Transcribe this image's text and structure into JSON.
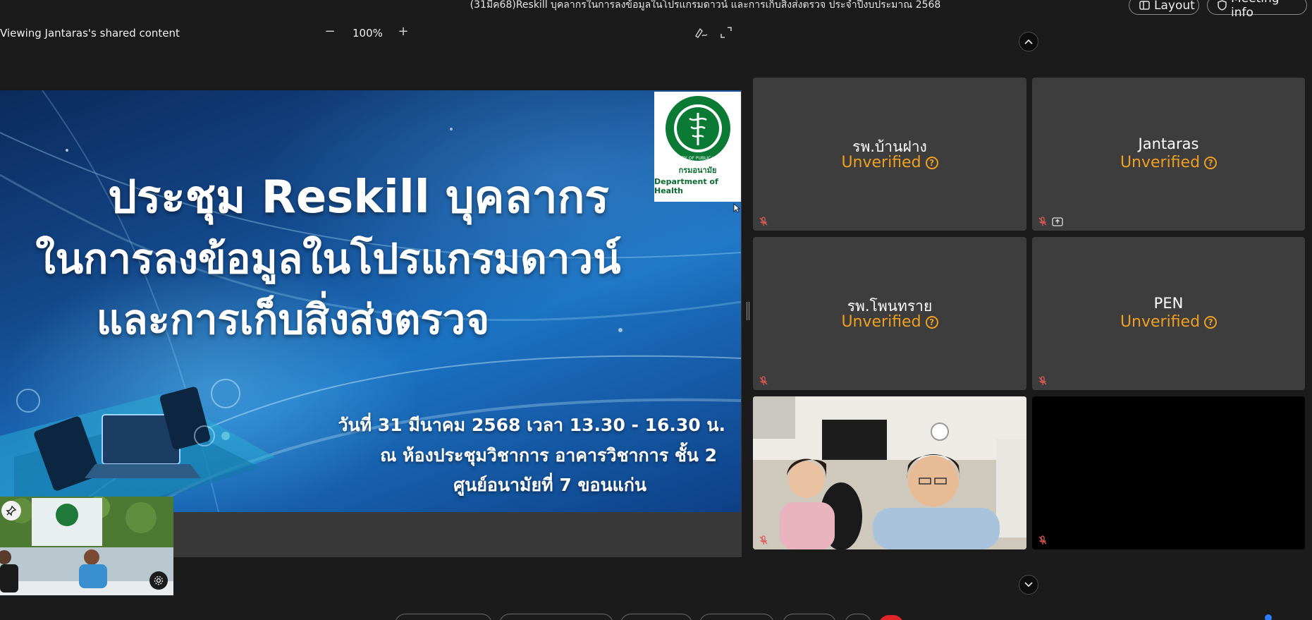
{
  "meeting": {
    "title": "(31มีค68)Reskill บุคลากรในการลงข้อมูลในโปรแกรมดาวน์ และการเก็บสิ่งส่งตรวจ ประจำปีงบประมาณ 2568"
  },
  "top_actions": {
    "layout_label": "Layout",
    "meeting_info_label": "Meeting info"
  },
  "share_bar": {
    "label": "Viewing Jantaras's shared content",
    "zoom_level": "100%",
    "zoom_minus": "−",
    "zoom_plus": "+"
  },
  "slide": {
    "line1": "ประชุม Reskill บุคลากร",
    "line2": "ในการลงข้อมูลในโปรแกรมดาวน์",
    "line3": "และการเก็บสิ่งส่งตรวจ",
    "info1": "วันที่ 31 มีนาคม 2568 เวลา 13.30 - 16.30 น.",
    "info2": "ณ ห้องประชุมวิชาการ อาคารวิชาการ ชั้น 2",
    "info3": "ศูนย์อนามัยที่ 7 ขอนแก่น",
    "logo_seal_text": "MINISTRY OF PUBLIC HEALTH",
    "logo_th": "กรมอนามัย",
    "logo_en": "Department of Health"
  },
  "participants": [
    {
      "name": "รพ.บ้านฝาง",
      "status": "Unverified"
    },
    {
      "name": "Jantaras",
      "status": "Unverified"
    },
    {
      "name": "รพ.โพนทราย",
      "status": "Unverified"
    },
    {
      "name": "PEN",
      "status": "Unverified"
    }
  ],
  "colors": {
    "unverified": "#f0a020",
    "muted_mic": "#e05a5a",
    "end_call": "#e0242b"
  },
  "icons": {
    "help": "?"
  }
}
